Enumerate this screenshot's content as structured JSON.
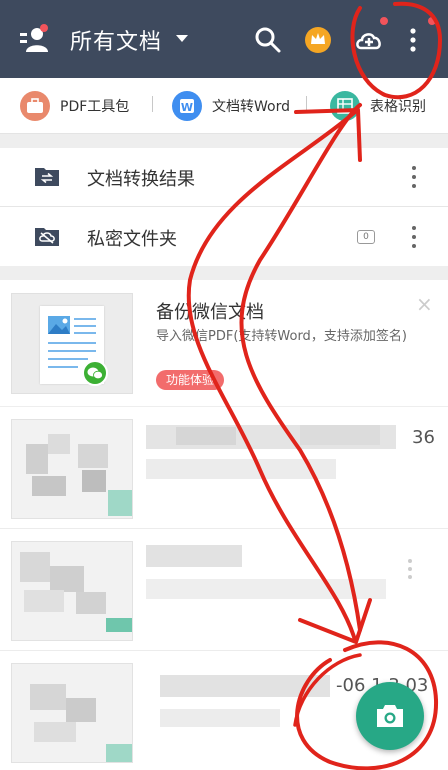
{
  "appbar": {
    "title": "所有文档",
    "icons": [
      "user-menu-icon",
      "caret-down-icon",
      "search-icon",
      "crown-icon",
      "cloud-upload-icon",
      "more-vertical-icon"
    ]
  },
  "tools": [
    {
      "label": "PDF工具包",
      "icon": "toolbox-icon",
      "color": "#e9896c"
    },
    {
      "label": "文档转Word",
      "icon": "word-icon",
      "color": "#3f8ef0"
    },
    {
      "label": "表格识别",
      "icon": "table-icon",
      "color": "#3ab8a0"
    }
  ],
  "folders": [
    {
      "label": "文档转换结果",
      "icon": "convert-folder-icon"
    },
    {
      "label": "私密文件夹",
      "icon": "cloud-folder-icon",
      "count": "0"
    }
  ],
  "promo": {
    "title": "备份微信文档",
    "subtitle": "导入微信PDF(支持转Word，支持添加签名)",
    "tag": "功能体验",
    "close": "×"
  },
  "documents": [
    {
      "meta_fragment": "36"
    },
    {
      "meta_fragment": ""
    },
    {
      "meta_fragment": "-06 1 3 03"
    }
  ],
  "fab": {
    "icon": "camera-icon"
  },
  "colors": {
    "appbar": "#3e4a5e",
    "accent": "#27a886",
    "annotation": "#e0241b"
  }
}
